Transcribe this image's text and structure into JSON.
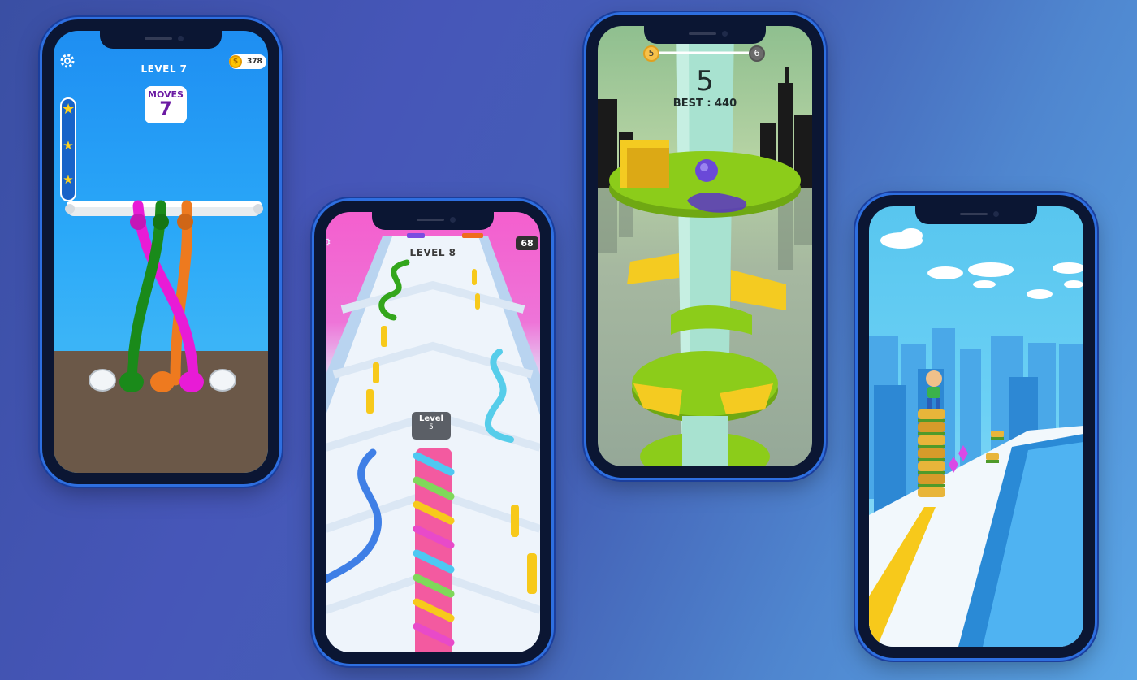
{
  "rope_game": {
    "level_label": "LEVEL 7",
    "coins": "378",
    "coin_symbol": "$",
    "moves_label": "MOVES",
    "moves_value": "7",
    "stars": 3,
    "rope_colors": [
      "#e81bd6",
      "#1a8a1a",
      "#ee7a1f"
    ]
  },
  "rope_runner": {
    "level_label": "LEVEL 8",
    "counter": "68",
    "player_tag_label": "Level",
    "player_tag_value": "5"
  },
  "helix_jump": {
    "current_level": "5",
    "next_level": "6",
    "score": "5",
    "best_label": "BEST : 440",
    "platform_colors": {
      "green": "#8ccc1a",
      "yellow": "#f4cb21"
    }
  },
  "sandwich_runner": {
    "stack_count": 6
  },
  "colors": {
    "phone_frame": "#0b1633",
    "phone_border": "#2e6fe0"
  }
}
